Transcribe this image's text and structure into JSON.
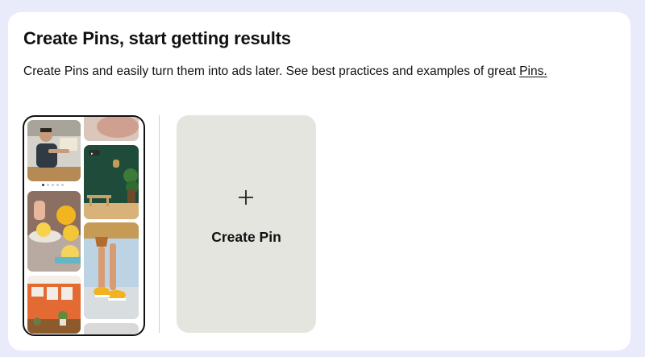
{
  "card": {
    "title": "Create Pins, start getting results",
    "description": "Create Pins and easily turn them into ads later. See best practices and examples of great ",
    "link_text": "Pins."
  },
  "preview": {
    "icon": "pin-preview-collage"
  },
  "create_pin": {
    "icon": "plus-icon",
    "label": "Create Pin"
  },
  "colors": {
    "page_background": "#e9ebfb",
    "card_background": "#ffffff",
    "create_tile_background": "#e5e5e0",
    "text": "#111111"
  }
}
